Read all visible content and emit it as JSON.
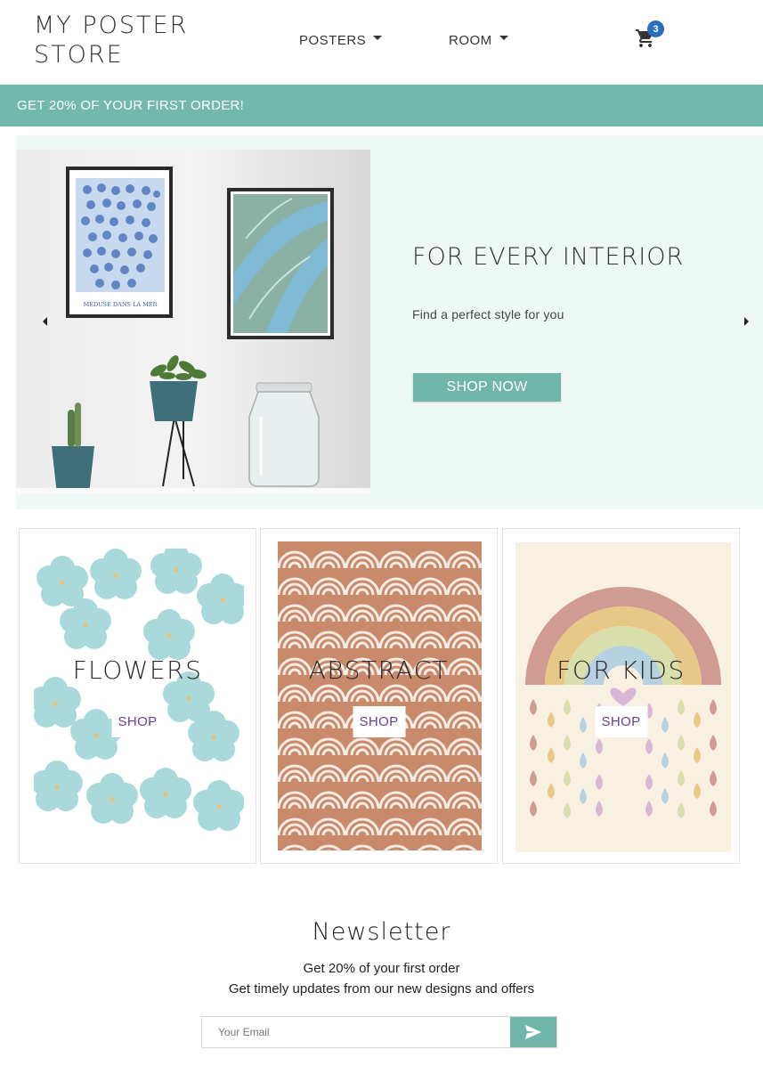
{
  "header": {
    "logo_line1": "MY POSTER",
    "logo_line2": "STORE",
    "nav": [
      {
        "label": "POSTERS"
      },
      {
        "label": "ROOM"
      }
    ],
    "cart_count": "3",
    "cart_icon": "shopping-cart-icon"
  },
  "promo": {
    "text": "GET 20% OF YOUR FIRST ORDER!",
    "color": "#72b8ab"
  },
  "hero": {
    "title": "FOR EVERY INTERIOR",
    "subtitle": "Find a perfect style for you",
    "button": "SHOP NOW",
    "poster_caption": "MÉDUSE DANS LA MER",
    "background": "#eef9f6"
  },
  "categories": [
    {
      "title": "FLOWERS",
      "button": "SHOP"
    },
    {
      "title": "ABSTRACT",
      "button": "SHOP"
    },
    {
      "title": "FOR KIDS",
      "button": "SHOP"
    }
  ],
  "newsletter": {
    "title": "Newsletter",
    "line1": "Get 20% of your first order",
    "line2": "Get timely updates from our new designs and offers",
    "placeholder": "Your Email",
    "send_icon": "send-icon"
  },
  "colors": {
    "accent": "#6fb5a8",
    "badge": "#2d6cc0",
    "shop_text": "#6b3d99"
  }
}
